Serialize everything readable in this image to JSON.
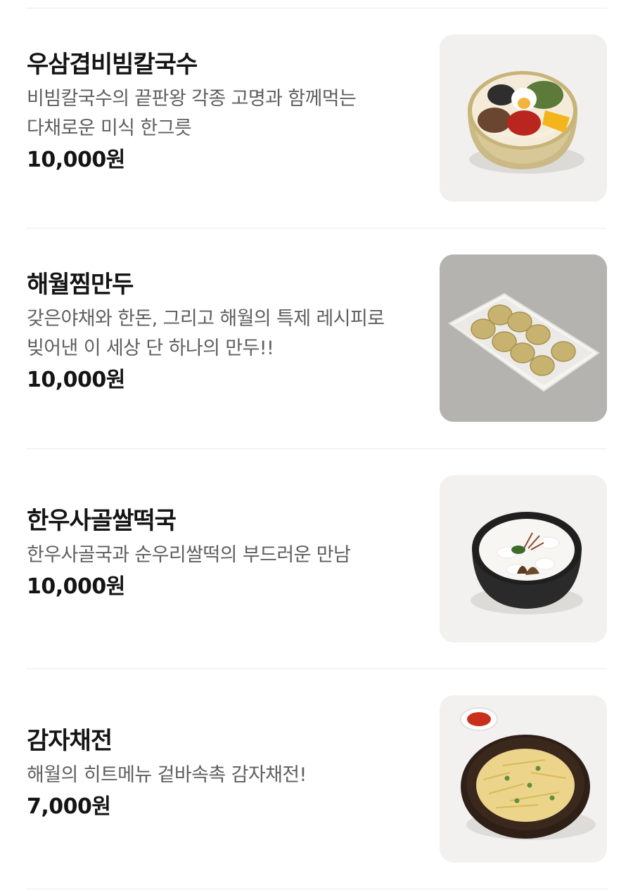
{
  "menu": {
    "items": [
      {
        "name": "우삼겹비빔칼국수",
        "description": "비빔칼국수의 끝판왕 각종 고명과 함께먹는 다채로운 미식 한그릇",
        "price": "10,000원",
        "image_icon": "bibim-kalguksu-photo"
      },
      {
        "name": "해월찜만두",
        "description": "갖은야채와 한돈, 그리고 해월의 특제 레시피로 빚어낸 이 세상 단 하나의 만두!!",
        "price": "10,000원",
        "image_icon": "steamed-dumplings-photo"
      },
      {
        "name": "한우사골쌀떡국",
        "description": "한우사골국과 순우리쌀떡의 부드러운 만남",
        "price": "10,000원",
        "image_icon": "tteokguk-photo"
      },
      {
        "name": "감자채전",
        "description": "해월의 히트메뉴 겉바속촉 감자채전!",
        "price": "7,000원",
        "image_icon": "potato-pancake-photo"
      }
    ]
  }
}
